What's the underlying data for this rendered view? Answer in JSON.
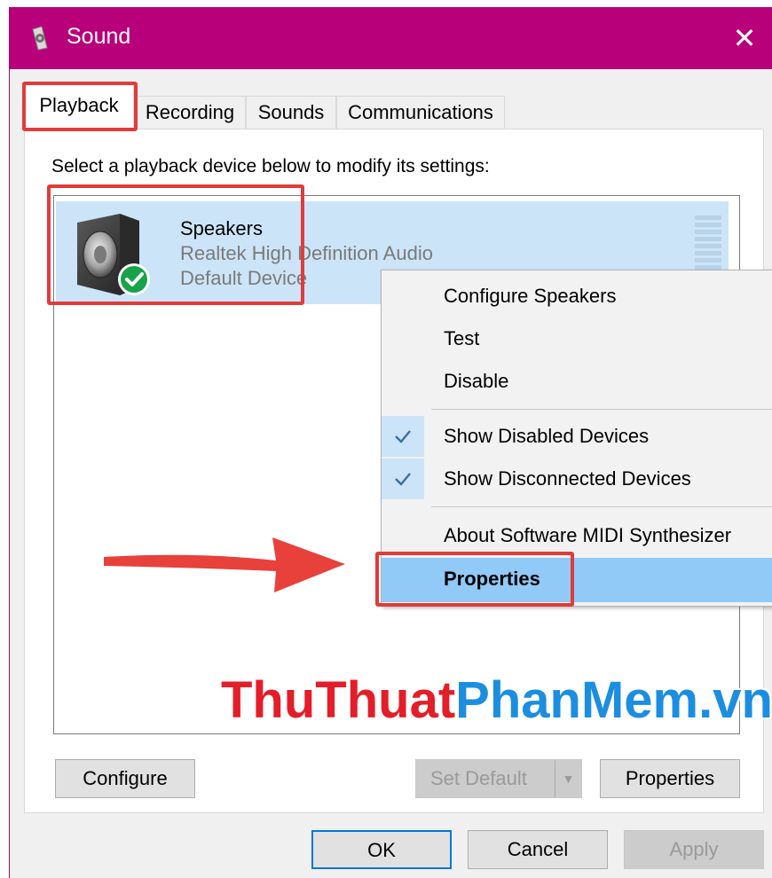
{
  "window": {
    "title": "Sound",
    "close_glyph": "✕",
    "titlebar_color": "#b8007a",
    "icon": "speaker-settings-icon"
  },
  "tabs": [
    {
      "label": "Playback",
      "selected": true
    },
    {
      "label": "Recording",
      "selected": false
    },
    {
      "label": "Sounds",
      "selected": false
    },
    {
      "label": "Communications",
      "selected": false
    }
  ],
  "panel": {
    "instruction": "Select a playback device below to modify its settings:"
  },
  "device": {
    "name": "Speakers",
    "driver": "Realtek High Definition Audio",
    "status": "Default Device",
    "icon": "speaker-icon",
    "status_icon": "default-check-icon",
    "selected": true
  },
  "buttons": {
    "configure": "Configure",
    "set_default": "Set Default",
    "set_default_arrow": "▼",
    "properties": "Properties",
    "ok": "OK",
    "cancel": "Cancel",
    "apply": "Apply"
  },
  "context_menu": {
    "items": [
      {
        "label": "Configure Speakers",
        "checked": false
      },
      {
        "label": "Test",
        "checked": false
      },
      {
        "label": "Disable",
        "checked": false
      },
      {
        "label": "Show Disabled Devices",
        "checked": true
      },
      {
        "label": "Show Disconnected Devices",
        "checked": true
      },
      {
        "label": "About Software MIDI Synthesizer",
        "checked": false
      },
      {
        "label": "Properties",
        "checked": false,
        "hovered": true
      }
    ]
  },
  "annotations": {
    "highlight_color": "#e13b3b",
    "arrow_color": "#e8413c"
  },
  "watermark": {
    "part1": "ThuThuat",
    "part2": "PhanMem",
    "part3": ".vn"
  }
}
